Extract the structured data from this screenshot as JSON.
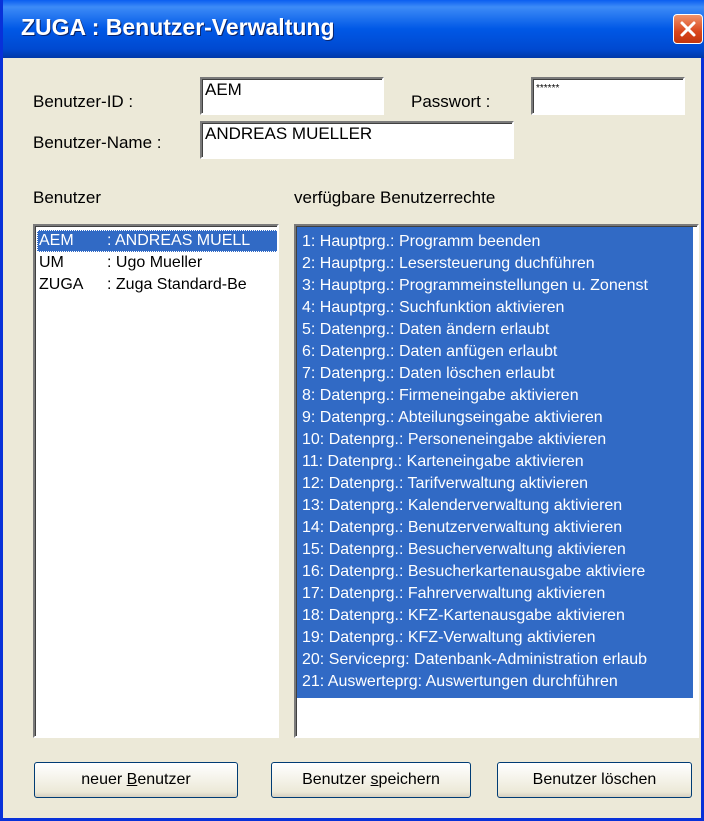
{
  "window": {
    "title": "ZUGA : Benutzer-Verwaltung"
  },
  "form": {
    "userid_label": "Benutzer-ID :",
    "userid_value": "AEM",
    "password_label": "Passwort :",
    "password_value": "******",
    "username_label": "Benutzer-Name :",
    "username_value": "ANDREAS MUELLER"
  },
  "users": {
    "header": "Benutzer",
    "items": [
      {
        "id": "AEM",
        "name": ": ANDREAS MUELL",
        "selected": true
      },
      {
        "id": "UM",
        "name": ": Ugo Mueller",
        "selected": false
      },
      {
        "id": "ZUGA",
        "name": ": Zuga Standard-Be",
        "selected": false
      }
    ]
  },
  "rights": {
    "header": "verfügbare Benutzerrechte",
    "items": [
      "1: Hauptprg.: Programm beenden",
      "2: Hauptprg.: Lesersteuerung duchführen",
      "3: Hauptprg.: Programmeinstellungen u. Zonenst",
      "4: Hauptprg.: Suchfunktion aktivieren",
      "5: Datenprg.: Daten ändern erlaubt",
      "6: Datenprg.: Daten anfügen erlaubt",
      "7: Datenprg.: Daten löschen erlaubt",
      "8: Datenprg.: Firmeneingabe aktivieren",
      "9: Datenprg.: Abteilungseingabe aktivieren",
      "10: Datenprg.: Personeneingabe aktivieren",
      "11: Datenprg.: Karteneingabe aktivieren",
      "12: Datenprg.: Tarifverwaltung aktivieren",
      "13: Datenprg.: Kalenderverwaltung aktivieren",
      "14: Datenprg.: Benutzerverwaltung aktivieren",
      "15: Datenprg.: Besucherverwaltung aktivieren",
      "16: Datenprg.: Besucherkartenausgabe aktiviere",
      "17: Datenprg.: Fahrerverwaltung aktivieren",
      "18: Datenprg.: KFZ-Kartenausgabe aktivieren",
      "19: Datenprg.: KFZ-Verwaltung aktivieren",
      "20: Serviceprg: Datenbank-Administration erlaub",
      "21: Auswerteprg: Auswertungen durchführen"
    ],
    "all_selected": true
  },
  "buttons": {
    "new_pre": "neuer ",
    "new_key": "B",
    "new_post": "enutzer",
    "save_pre": "Benutzer ",
    "save_key": "s",
    "save_post": "peichern",
    "delete_label": "Benutzer löschen"
  },
  "colors": {
    "selection": "#316ac5",
    "titlebar": "#0058e6",
    "dialog": "#ece9d8"
  },
  "icons": {
    "close": "close-icon"
  }
}
